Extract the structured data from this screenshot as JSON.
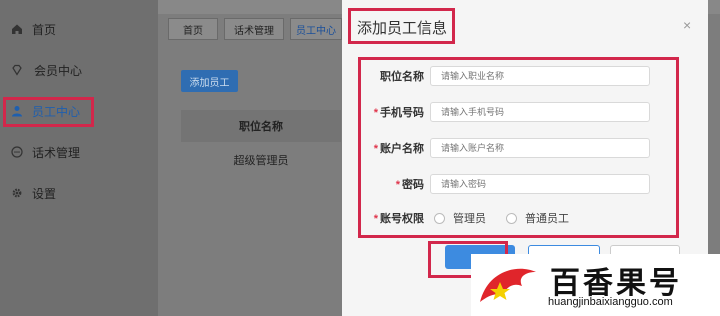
{
  "sidebar": {
    "items": [
      {
        "label": "首页",
        "icon": "home-icon"
      },
      {
        "label": "会员中心",
        "icon": "diamond-icon"
      },
      {
        "label": "员工中心",
        "icon": "user-icon",
        "active": true
      },
      {
        "label": "话术管理",
        "icon": "chat-icon"
      },
      {
        "label": "设置",
        "icon": "gear-icon"
      }
    ]
  },
  "tabs": [
    "首页",
    "话术管理",
    "员工中心"
  ],
  "main": {
    "add_button": "添加员工",
    "table": {
      "header": "职位名称",
      "rows": [
        "超级管理员"
      ]
    }
  },
  "modal": {
    "title": "添加员工信息",
    "close": "×",
    "fields": [
      {
        "label": "职位名称",
        "placeholder": "请输入职业名称",
        "required": false
      },
      {
        "label": "手机号码",
        "placeholder": "请输入手机号码",
        "required": true
      },
      {
        "label": "账户名称",
        "placeholder": "请输入账户名称",
        "required": true
      },
      {
        "label": "密码",
        "placeholder": "请输入密码",
        "required": true
      }
    ],
    "permission": {
      "label": "账号权限",
      "options": [
        "管理员",
        "普通员工"
      ]
    },
    "required_mark": "*"
  },
  "watermark": {
    "cn": "百香果号",
    "en": "huangjinbaixiangguo.com"
  },
  "colors": {
    "accent": "#2f6db2",
    "highlight": "#d2274b",
    "required": "#e0344b"
  }
}
